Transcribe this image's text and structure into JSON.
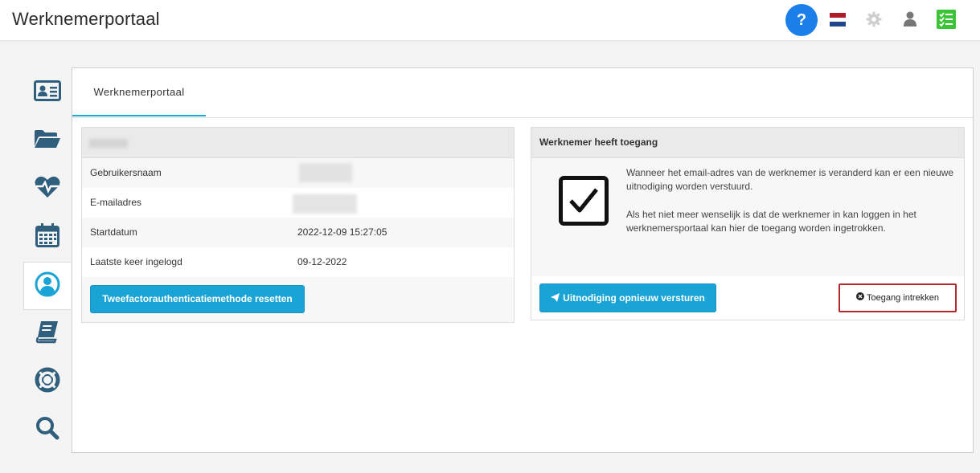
{
  "header": {
    "title": "Werknemerportaal",
    "help_label": "?"
  },
  "colors": {
    "accent": "#1aa4d6",
    "help": "#1a7fe8",
    "danger_border": "#b3262b",
    "status_green": "#3cc437"
  },
  "flag": [
    "#ae1c28",
    "#ffffff",
    "#21468b"
  ],
  "sidebar": {
    "items": [
      {
        "name": "id-card-icon"
      },
      {
        "name": "folder-icon"
      },
      {
        "name": "heartbeat-icon"
      },
      {
        "name": "calendar-icon"
      },
      {
        "name": "user-circle-icon",
        "active": true
      },
      {
        "name": "book-icon"
      },
      {
        "name": "lifebuoy-icon"
      },
      {
        "name": "search-icon"
      }
    ]
  },
  "tabs": [
    {
      "label": "Werknemerportaal"
    }
  ],
  "account_card": {
    "rows": [
      {
        "label": "Gebruikersnaam",
        "value": ""
      },
      {
        "label": "E-mailadres",
        "value": ""
      },
      {
        "label": "Startdatum",
        "value": "2022-12-09 15:27:05"
      },
      {
        "label": "Laatste keer ingelogd",
        "value": "09-12-2022"
      }
    ],
    "reset_button": "Tweefactorauthenticatiemethode resetten"
  },
  "access_card": {
    "title": "Werknemer heeft toegang",
    "paragraph1": "Wanneer het email-adres van de werknemer is veranderd kan er een nieuwe uitnodiging worden verstuurd.",
    "paragraph2": "Als het niet meer wenselijk is dat de werknemer in kan loggen in het werknemersportaal kan hier de toegang worden ingetrokken.",
    "resend_button": "Uitnodiging opnieuw versturen",
    "revoke_button": "Toegang intrekken"
  }
}
